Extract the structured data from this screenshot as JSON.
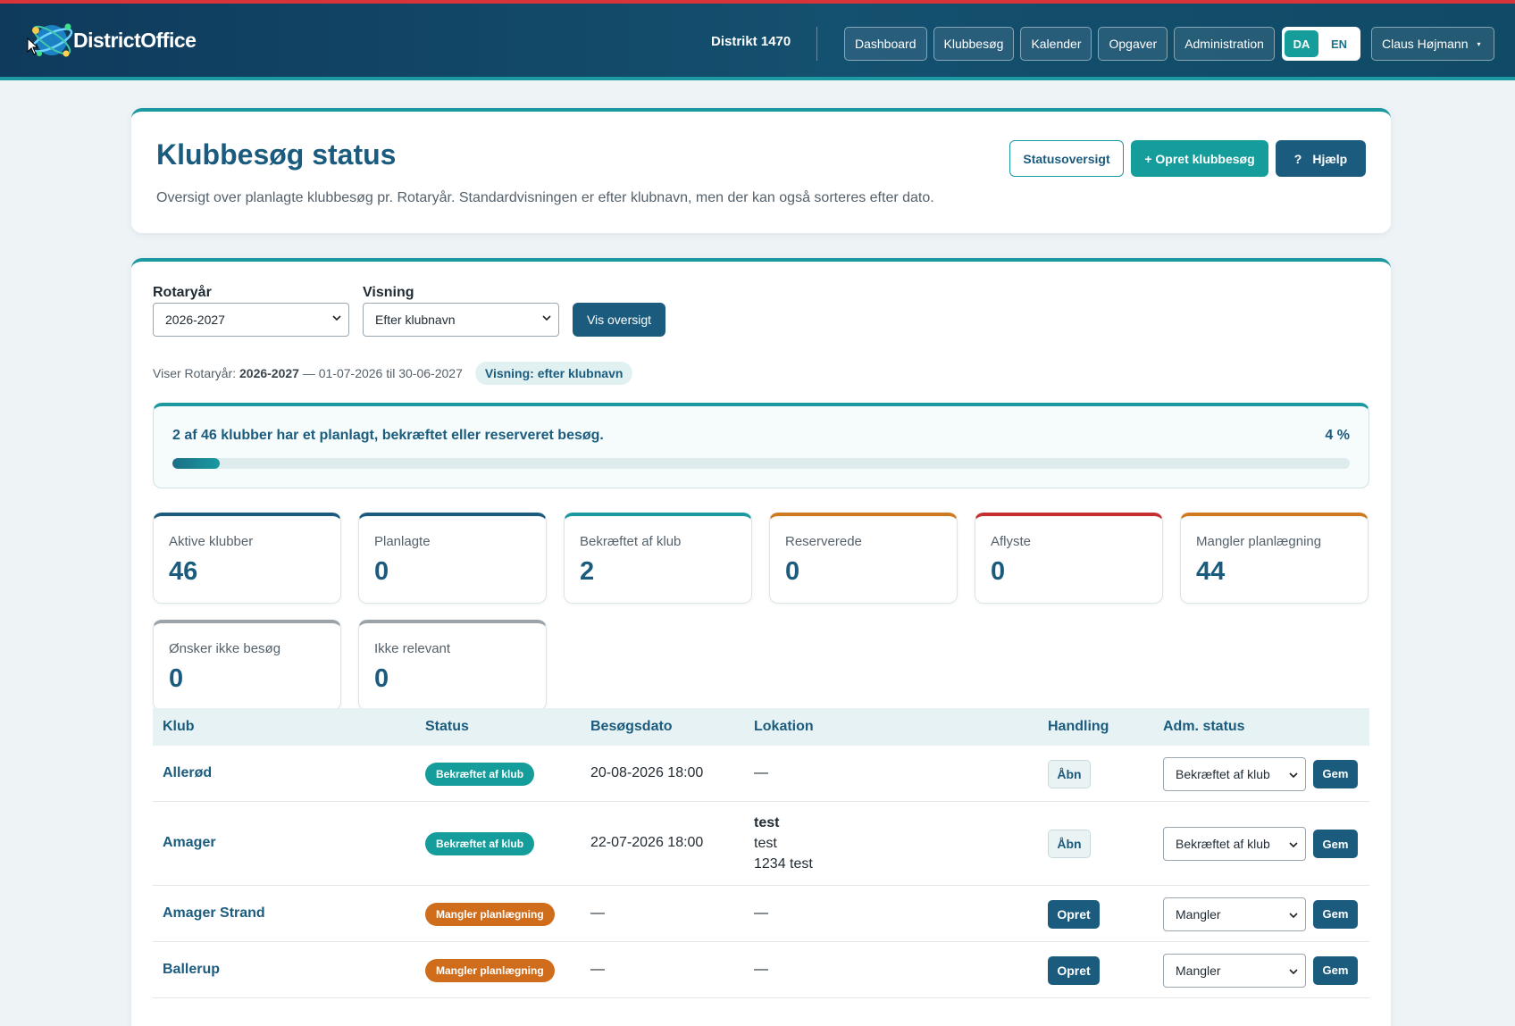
{
  "header": {
    "brand": "DistrictOffice",
    "district": "Distrikt 1470",
    "nav": [
      "Dashboard",
      "Klubbesøg",
      "Kalender",
      "Opgaver",
      "Administration"
    ],
    "languages": [
      "DA",
      "EN"
    ],
    "active_language": "DA",
    "user": "Claus Højmann"
  },
  "page": {
    "title": "Klubbesøg status",
    "description": "Oversigt over planlagte klubbesøg pr. Rotaryår. Standardvisningen er efter klubnavn, men der kan også sorteres efter dato.",
    "actions": {
      "status_overview": "Statusoversigt",
      "create_visit": "+ Opret klubbesøg",
      "help_icon": "?",
      "help": "Hjælp"
    }
  },
  "filters": {
    "rotary_year_label": "Rotaryår",
    "rotary_year_value": "2026-2027",
    "view_label": "Visning",
    "view_value": "Efter klubnavn",
    "show_button": "Vis oversigt"
  },
  "showing": {
    "prefix": "Viser Rotaryår:",
    "year": "2026-2027",
    "range": "— 01-07-2026 til 30-06-2027",
    "view_pill": "Visning: efter klubnavn"
  },
  "progress": {
    "text": "2 af 46 klubber har et planlagt, bekræftet eller reserveret besøg.",
    "percent_label": "4 %",
    "fraction": 0.04
  },
  "stats": [
    {
      "label": "Aktive klubber",
      "value": "46",
      "accent": "#1b5c7e"
    },
    {
      "label": "Planlagte",
      "value": "0",
      "accent": "#1b5c7e"
    },
    {
      "label": "Bekræftet af klub",
      "value": "2",
      "accent": "#1a9aa0"
    },
    {
      "label": "Reserverede",
      "value": "0",
      "accent": "#d07a1f"
    },
    {
      "label": "Aflyste",
      "value": "0",
      "accent": "#c62f2f"
    },
    {
      "label": "Mangler planlægning",
      "value": "44",
      "accent": "#d07a1f"
    },
    {
      "label": "Ønsker ikke besøg",
      "value": "0",
      "accent": "#9aa3a9"
    },
    {
      "label": "Ikke relevant",
      "value": "0",
      "accent": "#9aa3a9"
    }
  ],
  "table": {
    "headers": [
      "Klub",
      "Status",
      "Besøgsdato",
      "Lokation",
      "Handling",
      "Adm. status"
    ],
    "rows": [
      {
        "club": "Allerød",
        "status": "Bekræftet af klub",
        "status_color": "#159d9b",
        "date": "20-08-2026 18:00",
        "location": [
          "—"
        ],
        "action": "Åbn",
        "action_type": "open",
        "adm": "Bekræftet af klub",
        "save": "Gem"
      },
      {
        "club": "Amager",
        "status": "Bekræftet af klub",
        "status_color": "#159d9b",
        "date": "22-07-2026 18:00",
        "location": [
          "test",
          "test",
          "1234 test"
        ],
        "action": "Åbn",
        "action_type": "open",
        "adm": "Bekræftet af klub",
        "save": "Gem"
      },
      {
        "club": "Amager Strand",
        "status": "Mangler planlægning",
        "status_color": "#cf6d1d",
        "date": "—",
        "location": [
          "—"
        ],
        "action": "Opret",
        "action_type": "create",
        "adm": "Mangler",
        "save": "Gem"
      },
      {
        "club": "Ballerup",
        "status": "Mangler planlægning",
        "status_color": "#cf6d1d",
        "date": "—",
        "location": [
          "—"
        ],
        "action": "Opret",
        "action_type": "create",
        "adm": "Mangler",
        "save": "Gem"
      }
    ]
  }
}
